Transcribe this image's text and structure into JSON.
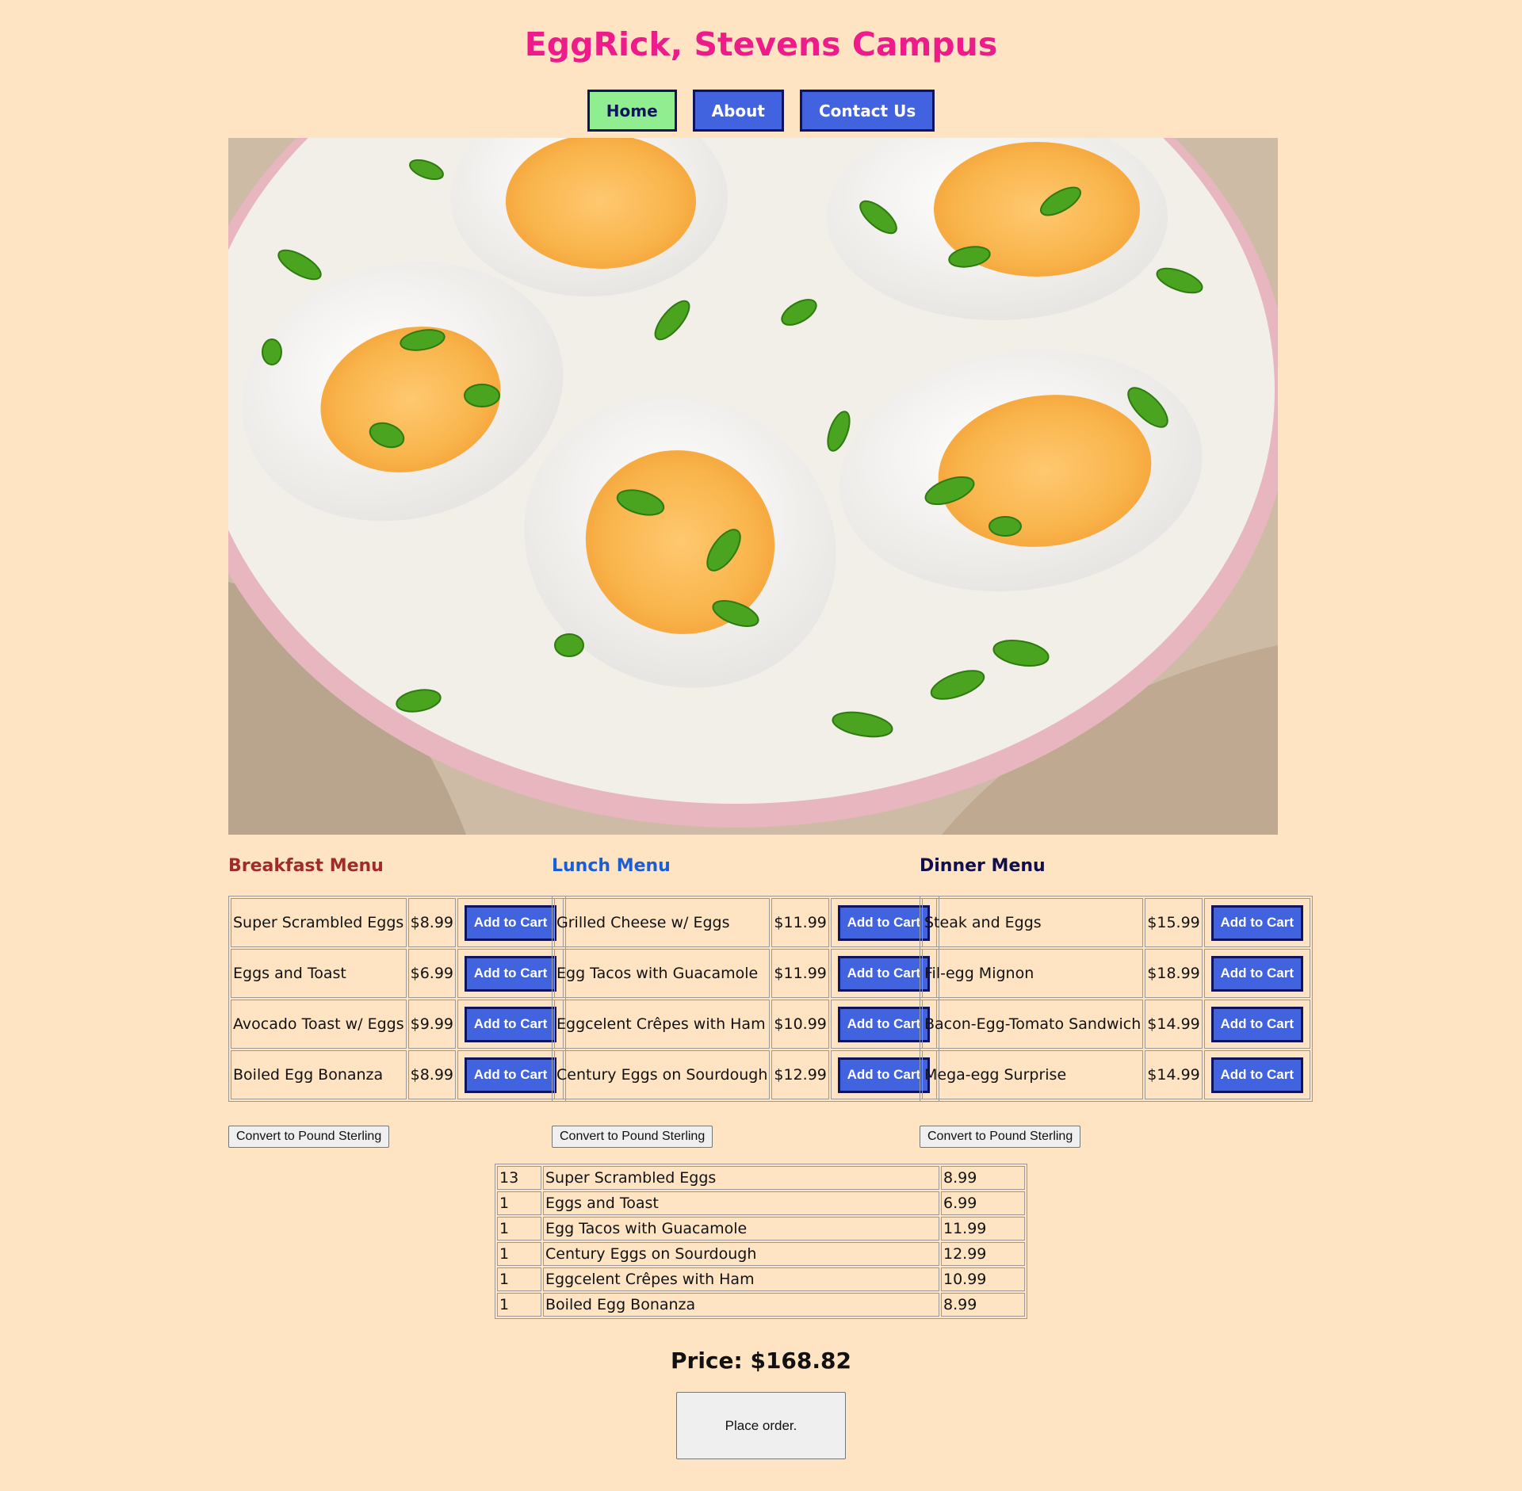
{
  "header": {
    "title": "EggRick, Stevens Campus"
  },
  "nav": {
    "home": "Home",
    "about": "About",
    "contact": "Contact Us"
  },
  "hero": {
    "alt": "Plate of halved boiled eggs with sliced green onions"
  },
  "menus": {
    "add_label": "Add to Cart",
    "convert_label": "Convert to Pound Sterling",
    "breakfast": {
      "title": "Breakfast Menu",
      "items": [
        {
          "name": "Super Scrambled Eggs",
          "price": "$8.99"
        },
        {
          "name": "Eggs and Toast",
          "price": "$6.99"
        },
        {
          "name": "Avocado Toast w/ Eggs",
          "price": "$9.99"
        },
        {
          "name": "Boiled Egg Bonanza",
          "price": "$8.99"
        }
      ]
    },
    "lunch": {
      "title": "Lunch Menu",
      "items": [
        {
          "name": "Grilled Cheese w/ Eggs",
          "price": "$11.99"
        },
        {
          "name": "Egg Tacos with Guacamole",
          "price": "$11.99"
        },
        {
          "name": "Eggcelent Crêpes with Ham",
          "price": "$10.99"
        },
        {
          "name": "Century Eggs on Sourdough",
          "price": "$12.99"
        }
      ]
    },
    "dinner": {
      "title": "Dinner Menu",
      "items": [
        {
          "name": "Steak and Eggs",
          "price": "$15.99"
        },
        {
          "name": "Fil-egg Mignon",
          "price": "$18.99"
        },
        {
          "name": "Bacon-Egg-Tomato Sandwich",
          "price": "$14.99"
        },
        {
          "name": "Mega-egg Surprise",
          "price": "$14.99"
        }
      ]
    }
  },
  "cart": {
    "rows": [
      {
        "qty": "13",
        "name": "Super Scrambled Eggs",
        "price": "8.99"
      },
      {
        "qty": "1",
        "name": "Eggs and Toast",
        "price": "6.99"
      },
      {
        "qty": "1",
        "name": "Egg Tacos with Guacamole",
        "price": "11.99"
      },
      {
        "qty": "1",
        "name": "Century Eggs on Sourdough",
        "price": "12.99"
      },
      {
        "qty": "1",
        "name": "Eggcelent Crêpes with Ham",
        "price": "10.99"
      },
      {
        "qty": "1",
        "name": "Boiled Egg Bonanza",
        "price": "8.99"
      }
    ],
    "total": "Price: $168.82",
    "place_order": "Place order."
  },
  "colors": {
    "background": "#ffe4c4",
    "title": "#ee1c8a",
    "button": "#4263e0",
    "button_border": "#0f1460",
    "active_nav": "#90ee90",
    "breakfast": "#a12a2a",
    "lunch": "#1a5ed6",
    "dinner": "#0f0f4f"
  }
}
